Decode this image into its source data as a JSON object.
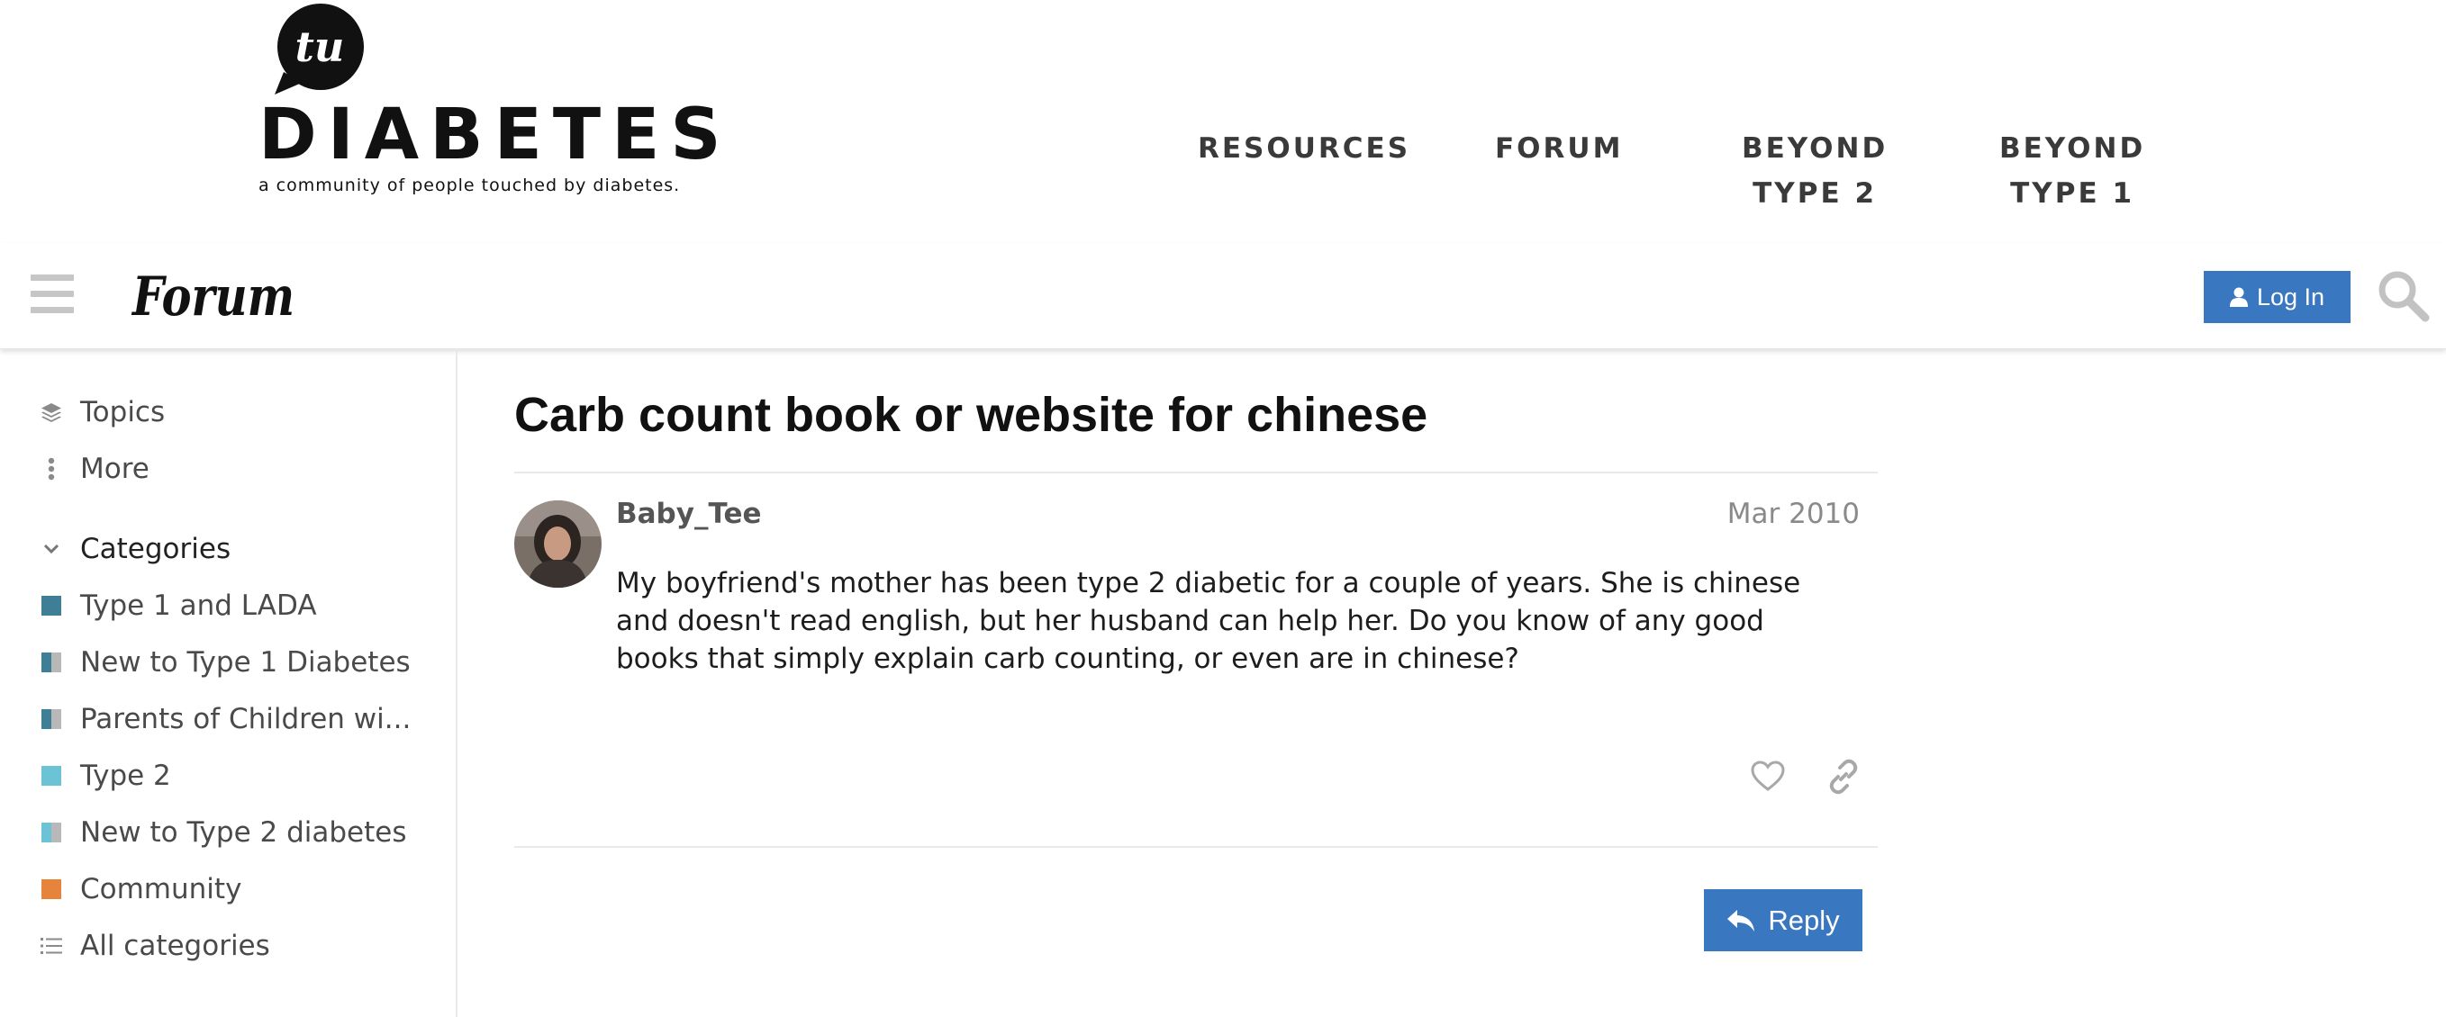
{
  "site": {
    "logo_badge": "tu",
    "logo_word": "DIABETES",
    "tagline": "a community of people touched by diabetes.",
    "nav": [
      {
        "line1": "RESOURCES",
        "line2": ""
      },
      {
        "line1": "FORUM",
        "line2": ""
      },
      {
        "line1": "BEYOND",
        "line2": "TYPE 2"
      },
      {
        "line1": "BEYOND",
        "line2": "TYPE 1"
      }
    ]
  },
  "header": {
    "forum_logo_text": "Forum",
    "login_label": "Log In",
    "icons": {
      "menu": "hamburger-icon",
      "search": "search-icon",
      "user": "user-icon"
    }
  },
  "sidebar": {
    "topics_label": "Topics",
    "more_label": "More",
    "categories_heading": "Categories",
    "categories": [
      {
        "label": "Type 1 and LADA",
        "colors": [
          "#3f7f96"
        ]
      },
      {
        "label": "New to Type 1 Diabetes",
        "colors": [
          "#3f7f96",
          "#b8b8b8"
        ]
      },
      {
        "label": "Parents of Children wi...",
        "colors": [
          "#3f7f96",
          "#b8b8b8"
        ]
      },
      {
        "label": "Type 2",
        "colors": [
          "#6cc3d5"
        ]
      },
      {
        "label": "New to Type 2 diabetes",
        "colors": [
          "#6cc3d5",
          "#b8b8b8"
        ]
      },
      {
        "label": "Community",
        "colors": [
          "#e5843a"
        ]
      }
    ],
    "all_categories_label": "All categories"
  },
  "topic": {
    "title": "Carb count book or website for chinese",
    "post": {
      "username": "Baby_Tee",
      "date": "Mar 2010",
      "body_lines": [
        "My boyfriend's mother has been type 2 diabetic for a couple of years. She is chinese",
        "and doesn't read english, but her husband can help her. Do you know of any good",
        "books that simply explain carb counting, or even are in chinese?"
      ]
    },
    "reply_label": "Reply"
  },
  "colors": {
    "accent": "#3a77c1",
    "text": "#222222",
    "muted": "#8a8a8a"
  }
}
